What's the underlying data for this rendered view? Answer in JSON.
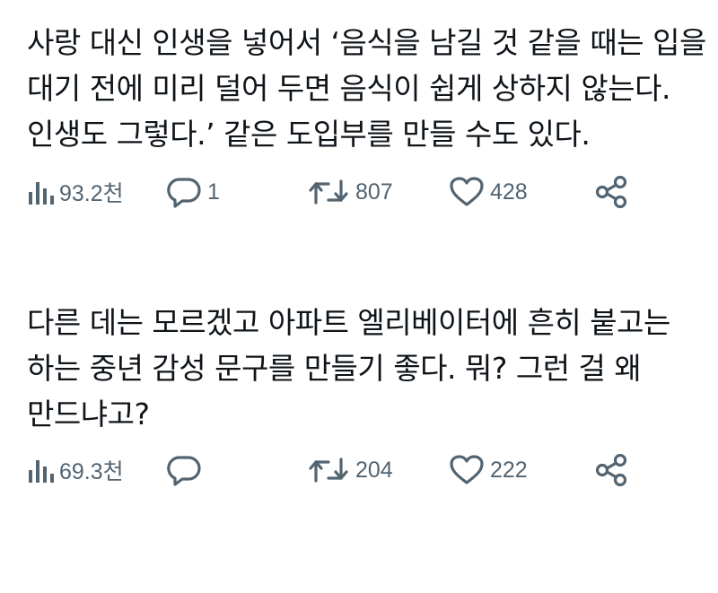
{
  "posts": [
    {
      "lines": [
        "사랑 대신 인생을 넣어서 ‘음식을 남길 것 같을 때는 입을",
        "대기 전에 미리 덜어 두면 음식이 쉽게 상하지 않는다.",
        "인생도 그렇다.’ 같은 도입부를 만들 수도 있다."
      ],
      "views": "93.2천",
      "replies": "1",
      "reposts": "807",
      "likes": "428"
    },
    {
      "lines": [
        "다른 데는 모르겠고 아파트 엘리베이터에 흔히 붙고는",
        "하는 중년 감성 문구를 만들기 좋다. 뭐? 그런 걸 왜",
        "만드냐고?"
      ],
      "views": "69.3천",
      "replies": "",
      "reposts": "204",
      "likes": "222"
    }
  ],
  "icons": {
    "views": "bar-chart-icon",
    "reply": "speech-bubble-icon",
    "repost": "repost-arrows-icon",
    "like": "heart-icon",
    "share": "share-icon"
  },
  "colors": {
    "text": "#0f1419",
    "icon_gray": "#536471",
    "background": "#ffffff"
  }
}
